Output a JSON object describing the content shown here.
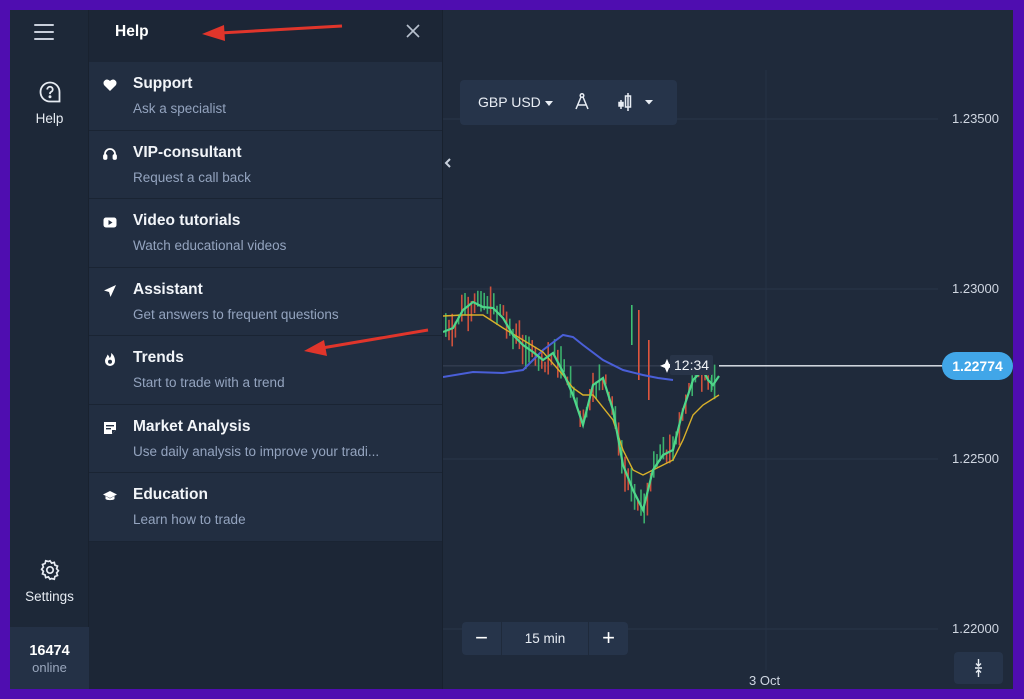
{
  "rail": {
    "menu_icon": "hamburger-icon",
    "help": {
      "label": "Help",
      "icon": "help-bubble-icon"
    },
    "settings": {
      "label": "Settings",
      "icon": "gear-icon"
    },
    "online": {
      "count": "16474",
      "label": "online"
    }
  },
  "panel": {
    "title": "Help",
    "close_icon": "close-icon",
    "items": [
      {
        "title": "Support",
        "subtitle": "Ask a specialist",
        "icon": "heart-icon"
      },
      {
        "title": "VIP-consultant",
        "subtitle": "Request a call back",
        "icon": "headset-icon"
      },
      {
        "title": "Video tutorials",
        "subtitle": "Watch educational videos",
        "icon": "play-icon"
      },
      {
        "title": "Assistant",
        "subtitle": "Get answers to frequent questions",
        "icon": "navigation-arrow-icon"
      },
      {
        "title": "Trends",
        "subtitle": "Start to trade with a trend",
        "icon": "flame-icon"
      },
      {
        "title": "Market Analysis",
        "subtitle": "Use daily analysis to improve your tradi...",
        "icon": "document-icon"
      },
      {
        "title": "Education",
        "subtitle": "Learn how to trade",
        "icon": "graduation-cap-icon"
      }
    ]
  },
  "chart": {
    "asset": "GBP USD",
    "timeframe": "15 min",
    "zoom_out": "−",
    "zoom_in": "+",
    "current_price": "1.22774",
    "current_time": "12:34",
    "date_label": "3 Oct",
    "price_levels": [
      "1.23500",
      "1.23000",
      "1.22500",
      "1.22000"
    ],
    "colors": {
      "up": "#3fbf73",
      "down": "#e0553d",
      "ma_fast": "#4ed68a",
      "ma_mid": "#d9b02a",
      "ma_slow": "#4a5fd8",
      "price_badge": "#41a6e8",
      "annotation_arrow": "#e0352b"
    }
  }
}
